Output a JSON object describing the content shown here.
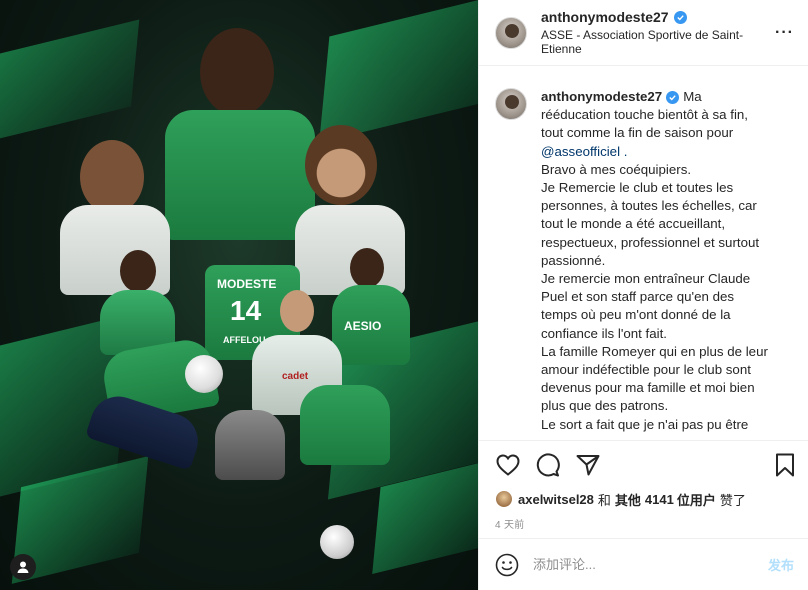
{
  "post": {
    "username": "anthonymodeste27",
    "location": "ASSE - Association Sportive de Saint-Etienne",
    "more_label": "···",
    "caption_username": "anthonymodeste27",
    "caption_lines": [
      "Ma",
      "rééducation touche bientôt à sa fin,",
      "tout comme la fin de saison pour",
      "@asseofficiel .",
      "Bravo à mes coéquipiers.",
      "Je Remercie le club et toutes les",
      "personnes, à toutes les échelles, car",
      "tout le monde a été accueillant,",
      "respectueux, professionnel et surtout",
      "passionné.",
      "Je remercie mon entraîneur Claude",
      "Puel et son staff parce qu'en des",
      "temps où peu m'ont donné de la",
      "confiance ils l'ont fait.",
      "La famille Romeyer qui en plus de leur",
      "amour indéfectible pour le club sont",
      "devenus pour ma famille et moi bien",
      "plus que des patrons.",
      "Le sort a fait que je n'ai pas pu être"
    ],
    "likes": {
      "liker": "axelwitsel28",
      "conj": "和",
      "others": "其他",
      "count": "4141",
      "unit": "位用户",
      "suffix": "赞了"
    },
    "time_ago": "4 天前"
  },
  "comment_box": {
    "placeholder": "添加评论...",
    "post_label": "发布"
  },
  "artwork": {
    "jersey_name": "MODESTE",
    "jersey_number": "14",
    "sponsor_text": "AESIO",
    "brand_text": "AFFELOU",
    "cheek_text": "cadet"
  },
  "icons": {
    "like": "heart-icon",
    "comment": "comment-icon",
    "share": "share-icon",
    "save": "bookmark-icon",
    "emoji": "emoji-icon",
    "user_tag": "user-tag-icon",
    "verified": "verified-badge-icon"
  },
  "colors": {
    "accent_blue": "#3897f0",
    "link": "#00376b",
    "post_disabled": "#b2dffc",
    "muted": "#8e8e8e",
    "art_green": "#2fa05a"
  }
}
